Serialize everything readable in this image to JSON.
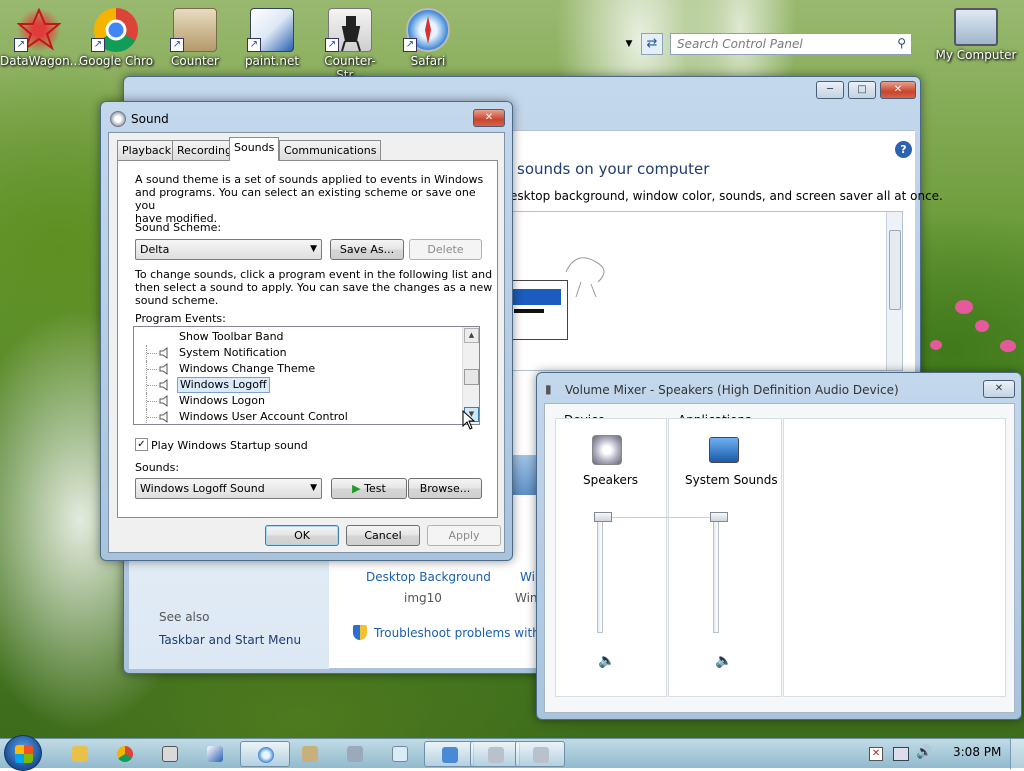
{
  "desktop": {
    "icons": [
      {
        "label": "DataWagon..."
      },
      {
        "label": "Google Chro"
      },
      {
        "label": "Counter"
      },
      {
        "label": "paint.net"
      },
      {
        "label": "Counter-Str..."
      },
      {
        "label": "Safari"
      },
      {
        "label": "My Computer"
      }
    ]
  },
  "control_panel": {
    "search_placeholder": "Search Control Panel",
    "heading": "sounds on your computer",
    "subheading": "esktop background, window color, sounds, and screen saver all at once.",
    "desktop_background_label": "Desktop Background",
    "desktop_background_value": "img10",
    "window_color_label_partial": "Wi",
    "window_color_value_partial": "Win",
    "see_also": "See also",
    "taskbar_link": "Taskbar and Start Menu",
    "troubleshoot_link": "Troubleshoot problems with tr"
  },
  "sound_dialog": {
    "title": "Sound",
    "tabs": [
      "Playback",
      "Recording",
      "Sounds",
      "Communications"
    ],
    "active_tab": "Sounds",
    "intro_text_1": "A sound theme is a set of sounds applied to events in Windows",
    "intro_text_2": "and programs.  You can select an existing scheme or save one you",
    "intro_text_3": "have modified.",
    "scheme_label": "Sound Scheme:",
    "scheme_value": "Delta",
    "save_as_label": "Save As...",
    "delete_label": "Delete",
    "change_text_1": "To change sounds, click a program event in the following list and",
    "change_text_2": "then select a sound to apply.  You can save the changes as a new",
    "change_text_3": "sound scheme.",
    "events_label": "Program Events:",
    "events": [
      {
        "label": "Show Toolbar Band",
        "has_sound": false
      },
      {
        "label": "System Notification",
        "has_sound": true
      },
      {
        "label": "Windows Change Theme",
        "has_sound": true
      },
      {
        "label": "Windows Logoff",
        "has_sound": true,
        "selected": true
      },
      {
        "label": "Windows Logon",
        "has_sound": true
      },
      {
        "label": "Windows User Account Control",
        "has_sound": true
      }
    ],
    "startup_checkbox_label": "Play Windows Startup sound",
    "startup_checked": true,
    "sounds_label": "Sounds:",
    "sound_value": "Windows Logoff Sound",
    "test_label": "Test",
    "browse_label": "Browse...",
    "ok_label": "OK",
    "cancel_label": "Cancel",
    "apply_label": "Apply"
  },
  "volume_mixer": {
    "title": "Volume Mixer - Speakers (High Definition Audio Device)",
    "device_header": "Device",
    "applications_header": "Applications",
    "device_name": "Speakers",
    "app_name": "System Sounds",
    "device_volume": 100,
    "app_volume": 100
  },
  "taskbar": {
    "clock": "3:08 PM"
  },
  "colors": {
    "accent": "#1a5fb0",
    "selection": "#dcebfc",
    "close_button": "#c8452c"
  }
}
